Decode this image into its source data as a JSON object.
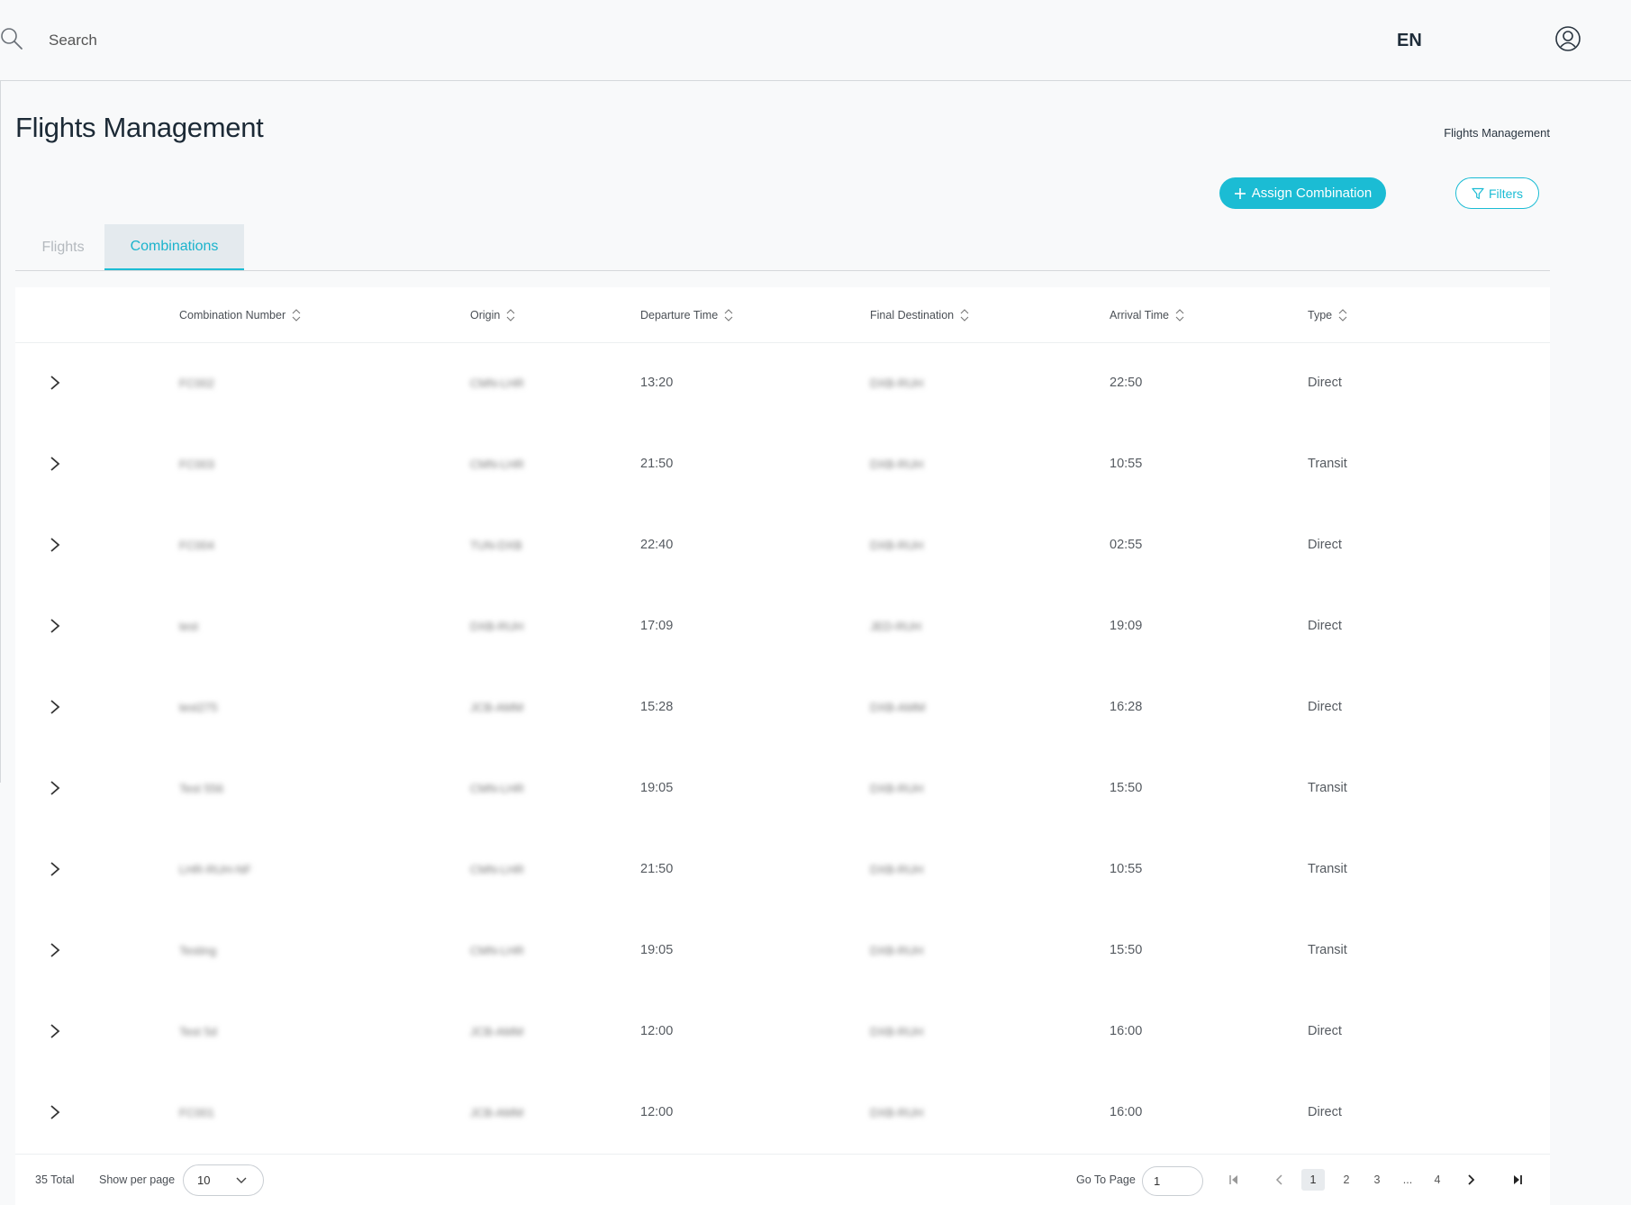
{
  "header": {
    "search_placeholder": "Search",
    "language": "EN"
  },
  "page": {
    "title": "Flights Management",
    "breadcrumb": "Flights Management"
  },
  "actions": {
    "assign_label": "Assign Combination",
    "filters_label": "Filters"
  },
  "tabs": [
    {
      "label": "Flights",
      "active": false
    },
    {
      "label": "Combinations",
      "active": true
    }
  ],
  "table": {
    "columns": [
      "Combination Number",
      "Origin",
      "Departure Time",
      "Final Destination",
      "Arrival Time",
      "Type"
    ],
    "rows": [
      {
        "combination": "FC002",
        "origin": "CMN-LHR",
        "departure": "13:20",
        "destination": "DXB-RUH",
        "arrival": "22:50",
        "type": "Direct"
      },
      {
        "combination": "FC003",
        "origin": "CMN-LHR",
        "departure": "21:50",
        "destination": "DXB-RUH",
        "arrival": "10:55",
        "type": "Transit"
      },
      {
        "combination": "FC004",
        "origin": "TUN-DXB",
        "departure": "22:40",
        "destination": "DXB-RUH",
        "arrival": "02:55",
        "type": "Direct"
      },
      {
        "combination": "test",
        "origin": "DXB-RUH",
        "departure": "17:09",
        "destination": "JED-RUH",
        "arrival": "19:09",
        "type": "Direct"
      },
      {
        "combination": "test275",
        "origin": "JCB-AMM",
        "departure": "15:28",
        "destination": "DXB-AMM",
        "arrival": "16:28",
        "type": "Direct"
      },
      {
        "combination": "Test 556",
        "origin": "CMN-LHR",
        "departure": "19:05",
        "destination": "DXB-RUH",
        "arrival": "15:50",
        "type": "Transit"
      },
      {
        "combination": "LHR-RUH-NF",
        "origin": "CMN-LHR",
        "departure": "21:50",
        "destination": "DXB-RUH",
        "arrival": "10:55",
        "type": "Transit"
      },
      {
        "combination": "Testing",
        "origin": "CMN-LHR",
        "departure": "19:05",
        "destination": "DXB-RUH",
        "arrival": "15:50",
        "type": "Transit"
      },
      {
        "combination": "Test 5d",
        "origin": "JCB-AMM",
        "departure": "12:00",
        "destination": "DXB-RUH",
        "arrival": "16:00",
        "type": "Direct"
      },
      {
        "combination": "FC001",
        "origin": "JCB-AMM",
        "departure": "12:00",
        "destination": "DXB-RUH",
        "arrival": "16:00",
        "type": "Direct"
      }
    ]
  },
  "footer": {
    "total": "35 Total",
    "per_page_label": "Show per page",
    "per_page_value": "10",
    "goto_label": "Go To Page",
    "goto_value": "1",
    "pages": [
      "1",
      "2",
      "3",
      "...",
      "4"
    ],
    "current_page": "1"
  },
  "colors": {
    "accent": "#1bbcd4",
    "background": "#f8f9fa",
    "title": "#1c2a36"
  },
  "icons": [
    "search-icon",
    "user-icon",
    "plus-icon",
    "filter-icon",
    "sort-icon",
    "chevron-right-icon",
    "chevron-down-icon",
    "first-page-icon",
    "prev-page-icon",
    "next-page-icon",
    "last-page-icon"
  ]
}
